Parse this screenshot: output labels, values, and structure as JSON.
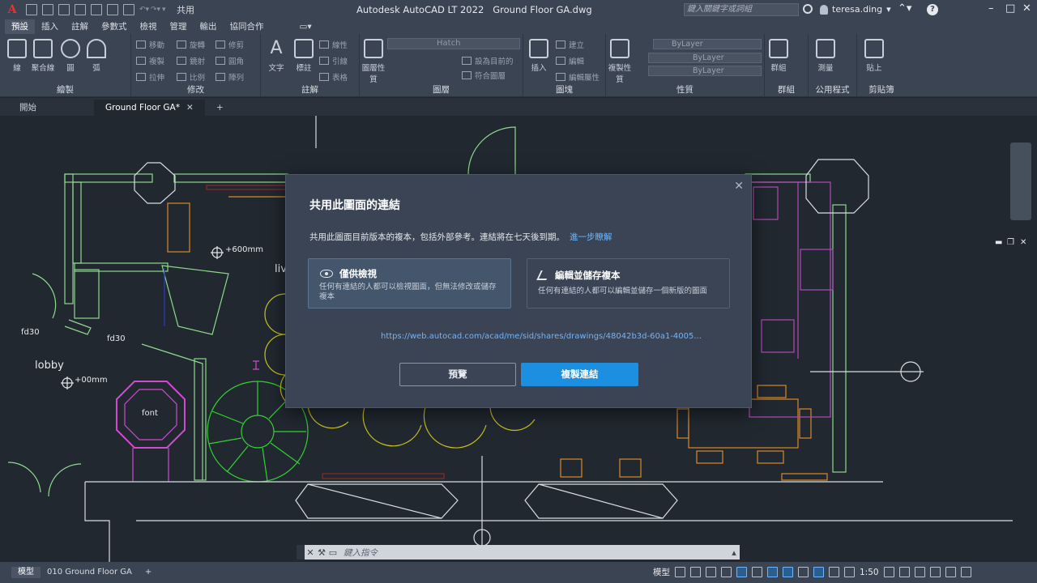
{
  "window": {
    "app_title": "Autodesk AutoCAD LT 2022",
    "file_name": "Ground Floor  GA.dwg",
    "search_placeholder": "鍵入關鍵字或詞組",
    "user": "teresa.ding",
    "share_label": "共用"
  },
  "ribbon_tabs": [
    "預設",
    "插入",
    "註解",
    "參數式",
    "檢視",
    "管理",
    "輸出",
    "協同合作"
  ],
  "ribbon_panels": {
    "draw": {
      "title": "繪製",
      "line": "線",
      "polyline": "聚合線",
      "circle": "圓",
      "arc": "弧"
    },
    "modify": {
      "title": "修改",
      "move": "移動",
      "rotate": "旋轉",
      "trim": "修剪",
      "copy": "複製",
      "mirror": "鏡射",
      "fillet": "圓角",
      "stretch": "拉伸",
      "scale": "比例",
      "array": "陣列"
    },
    "annotation": {
      "title": "註解",
      "text": "文字",
      "dimension": "標註",
      "linear": "線性",
      "leader": "引線",
      "table": "表格"
    },
    "layers": {
      "title": "圖層",
      "layer_props": "圖層性質",
      "current_layer": "Hatch",
      "make_current": "設為目前的",
      "match_layer": "符合圖層"
    },
    "block": {
      "title": "圖塊",
      "insert": "插入",
      "create": "建立",
      "edit": "編輯",
      "edit_attr": "編輯屬性"
    },
    "properties": {
      "title": "性質",
      "match_props": "複製性質",
      "color": "ByLayer",
      "linetype": "ByLayer",
      "lineweight": "ByLayer"
    },
    "groups": {
      "title": "群組",
      "group": "群組"
    },
    "utilities": {
      "title": "公用程式",
      "measure": "測量"
    },
    "clipboard": {
      "title": "剪貼簿",
      "paste": "貼上"
    }
  },
  "doc_tabs": [
    "開始",
    "Ground Floor GA*"
  ],
  "drawing_labels": {
    "lobby": "lobby",
    "font": "font",
    "fd30_left": "fd30",
    "fd30_mid": "fd30",
    "dim_600": "+600mm",
    "dim_00": "+00mm",
    "liv": "liv"
  },
  "share_dialog": {
    "title": "共用此圖面的連結",
    "description": "共用此圖面目前版本的複本，包括外部參考。連結將在七天後到期。",
    "learn_more": "進一步瞭解",
    "view_only": {
      "title": "僅供檢視",
      "description": "任何有連結的人都可以檢視圖面，但無法修改或儲存複本"
    },
    "edit_save": {
      "title": "編輯並儲存複本",
      "description": "任何有連結的人都可以編輯並儲存一個新版的圖面"
    },
    "url": "https://web.autocad.com/acad/me/sid/shares/drawings/48042b3d-60a1-4005...",
    "preview_button": "預覽",
    "copy_button": "複製連結"
  },
  "command_line": {
    "placeholder": "鍵入指令"
  },
  "status_bar": {
    "tabs": [
      "模型",
      "010 Ground Floor GA"
    ],
    "model_label": "模型",
    "scale": "1:50"
  },
  "colors": {
    "accent_blue": "#1d8fe1",
    "link_blue": "#6db6ff",
    "canvas": "#212830",
    "walls": "#8fd98f",
    "furniture_orange": "#d98a2b",
    "magenta": "#d24ad2",
    "yellow_plant": "#c9c21b"
  }
}
